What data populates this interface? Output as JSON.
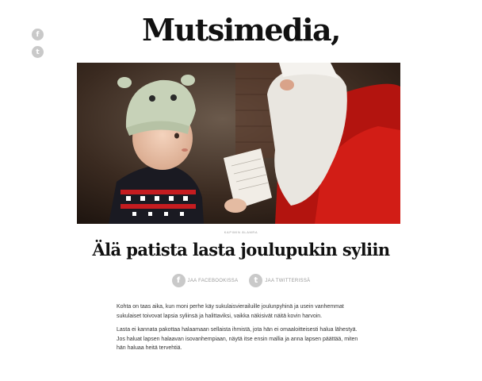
{
  "site": {
    "logo": "Mutsimedia,"
  },
  "share_rail": {
    "facebook_icon": "f",
    "twitter_icon": "t"
  },
  "hero": {
    "alt": "Lapsi ja joulupukki"
  },
  "article": {
    "photo_credit": "KAPIMIN ÄLAMRA",
    "title": "Älä patista lasta joulupukin syliin",
    "share": {
      "facebook_label": "JAA FACEBOOKISSA",
      "twitter_label": "JAA TWITTERISSÄ"
    },
    "paragraphs": [
      "Kohta on taas aika, kun moni perhe käy sukulaisvierailuille joulunpyhinä ja usein vanhemmat sukulaiset toivovat lapsia syliinsä ja halittaviksi, vaikka näkisivät näitä kovin harvoin.",
      "Lasta ei kannata pakottaa halaamaan sellaista ihmistä, jota hän ei omaaloitteisesti halua lähestyä. Jos haluat lapsen halaavan isovanhempiaan, näytä itse ensin mallia ja anna lapsen päättää, miten hän haluaa heitä tervehtiä."
    ]
  },
  "colors": {
    "icon_grey": "#c9c9c9",
    "santa_red": "#c41a17"
  }
}
